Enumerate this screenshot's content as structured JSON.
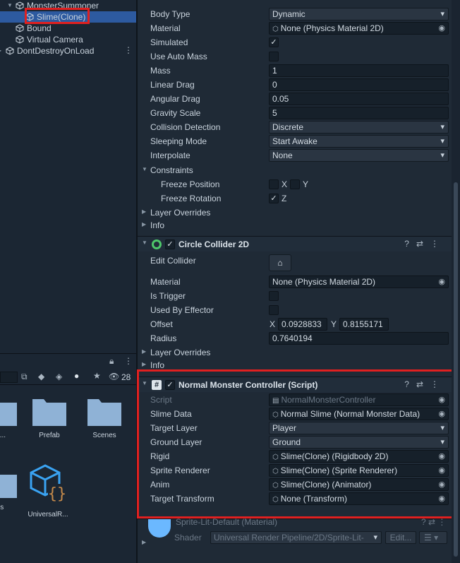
{
  "hierarchy": {
    "rows": [
      {
        "label": "MonsterSummoner",
        "indent": 2,
        "expanded": true
      },
      {
        "label": "Slime(Clone)",
        "indent": 3,
        "selected": true
      },
      {
        "label": "Bound",
        "indent": 2
      },
      {
        "label": "Virtual Camera",
        "indent": 2
      },
      {
        "label": "DontDestroyOnLoad",
        "indent": 1,
        "expanded": false
      }
    ],
    "menu_icon": "⋮"
  },
  "project": {
    "toolbar": {
      "search_value": "",
      "count": "28"
    },
    "assets": [
      {
        "label": "st...",
        "kind": "folder"
      },
      {
        "label": "Prefab",
        "kind": "folder"
      },
      {
        "label": "Scenes",
        "kind": "folder"
      },
      {
        "label": "gs",
        "kind": "folder"
      },
      {
        "label": "UniversalR...",
        "kind": "asset"
      }
    ]
  },
  "rigidbody": {
    "rows": [
      {
        "label": "Body Type",
        "type": "dropdown",
        "value": "Dynamic"
      },
      {
        "label": "Material",
        "type": "object",
        "value": "None (Physics Material 2D)"
      },
      {
        "label": "Simulated",
        "type": "check",
        "value": true
      },
      {
        "label": "Use Auto Mass",
        "type": "check",
        "value": false
      },
      {
        "label": "Mass",
        "type": "text",
        "value": "1"
      },
      {
        "label": "Linear Drag",
        "type": "text",
        "value": "0"
      },
      {
        "label": "Angular Drag",
        "type": "text",
        "value": "0.05"
      },
      {
        "label": "Gravity Scale",
        "type": "text",
        "value": "5"
      },
      {
        "label": "Collision Detection",
        "type": "dropdown",
        "value": "Discrete"
      },
      {
        "label": "Sleeping Mode",
        "type": "dropdown",
        "value": "Start Awake"
      },
      {
        "label": "Interpolate",
        "type": "dropdown",
        "value": "None"
      }
    ],
    "constraints": {
      "label": "Constraints",
      "freeze_position": {
        "label": "Freeze Position",
        "x": "X",
        "y": "Y"
      },
      "freeze_rotation": {
        "label": "Freeze Rotation",
        "z": "Z"
      }
    },
    "layer_overrides": "Layer Overrides",
    "info": "Info"
  },
  "circle_collider": {
    "title": "Circle Collider 2D",
    "edit_collider": "Edit Collider",
    "material": {
      "label": "Material",
      "value": "None (Physics Material 2D)"
    },
    "is_trigger": "Is Trigger",
    "used_by_effector": "Used By Effector",
    "offset": {
      "label": "Offset",
      "x_label": "X",
      "x": "0.0928833",
      "y_label": "Y",
      "y": "0.8155171"
    },
    "radius": {
      "label": "Radius",
      "value": "0.7640194"
    },
    "layer_overrides": "Layer Overrides",
    "info": "Info"
  },
  "script": {
    "title": "Normal Monster Controller (Script)",
    "rows": [
      {
        "label": "Script",
        "type": "script",
        "value": "NormalMonsterController"
      },
      {
        "label": "Slime Data",
        "type": "object",
        "value": "Normal Slime (Normal Monster Data)"
      },
      {
        "label": "Target Layer",
        "type": "dropdown",
        "value": "Player"
      },
      {
        "label": "Ground Layer",
        "type": "dropdown",
        "value": "Ground"
      },
      {
        "label": "Rigid",
        "type": "object",
        "value": "Slime(Clone) (Rigidbody 2D)"
      },
      {
        "label": "Sprite Renderer",
        "type": "object",
        "value": "Slime(Clone) (Sprite Renderer)"
      },
      {
        "label": "Anim",
        "type": "object",
        "value": "Slime(Clone) (Animator)"
      },
      {
        "label": "Target Transform",
        "type": "object",
        "value": "None (Transform)"
      }
    ]
  },
  "material": {
    "name": "Sprite-Lit-Default (Material)",
    "shader_label": "Shader",
    "shader_value": "Universal Render Pipeline/2D/Sprite-Lit-",
    "edit_button": "Edit...",
    "list_icon": "☰"
  },
  "colors": {
    "accent": "#e02020",
    "selection": "#2d5aa0"
  }
}
